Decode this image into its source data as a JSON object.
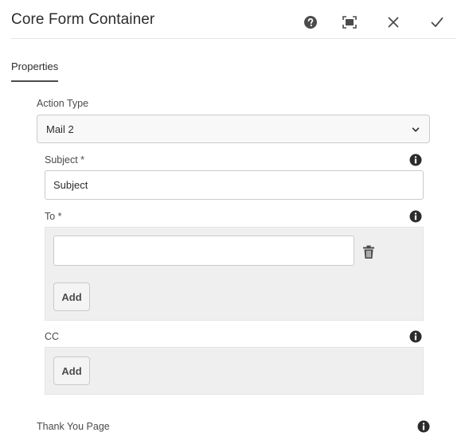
{
  "dialog": {
    "title": "Core Form Container"
  },
  "tabs": [
    {
      "label": "Properties"
    }
  ],
  "form": {
    "action_type": {
      "label": "Action Type",
      "selected": "Mail 2"
    },
    "subject": {
      "label": "Subject *",
      "value": "Subject"
    },
    "to": {
      "label": "To *",
      "items": [
        {
          "value": ""
        }
      ],
      "add_label": "Add"
    },
    "cc": {
      "label": "CC",
      "add_label": "Add"
    },
    "thank_you": {
      "label": "Thank You Page"
    }
  },
  "icons": {
    "help": "help-icon",
    "fullscreen": "fullscreen-icon",
    "close": "close-icon",
    "done": "checkmark-icon",
    "info": "info-icon",
    "chevron": "chevron-down-icon",
    "delete": "trash-icon"
  },
  "colors": {
    "text": "#2c2c2c",
    "icon": "#4b4b4b",
    "field_bg": "#f8f8f8",
    "multifield_bg": "#efefef"
  }
}
